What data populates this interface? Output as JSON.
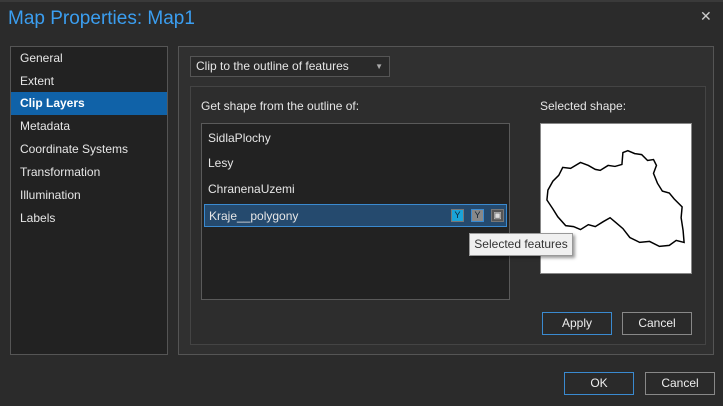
{
  "title": "Map Properties: Map1",
  "close_label": "✕",
  "sidebar": {
    "items": [
      {
        "label": "General"
      },
      {
        "label": "Extent"
      },
      {
        "label": "Clip Layers",
        "selected": true
      },
      {
        "label": "Metadata"
      },
      {
        "label": "Coordinate Systems"
      },
      {
        "label": "Transformation"
      },
      {
        "label": "Illumination"
      },
      {
        "label": "Labels"
      }
    ]
  },
  "clip": {
    "mode": "Clip to the outline of features",
    "shape_from_label": "Get shape from the outline of:",
    "layers": [
      {
        "label": "SidlaPlochy"
      },
      {
        "label": "Lesy"
      },
      {
        "label": "ChranenaUzemi"
      },
      {
        "label": "Kraje__polygony",
        "selected": true
      }
    ],
    "selected_shape_label": "Selected shape:",
    "tooltip": "Selected features",
    "apply": "Apply",
    "cancel": "Cancel"
  },
  "footer": {
    "ok": "OK",
    "cancel": "Cancel"
  },
  "colors": {
    "accent": "#3b9ef0",
    "selection": "#1062a8"
  }
}
